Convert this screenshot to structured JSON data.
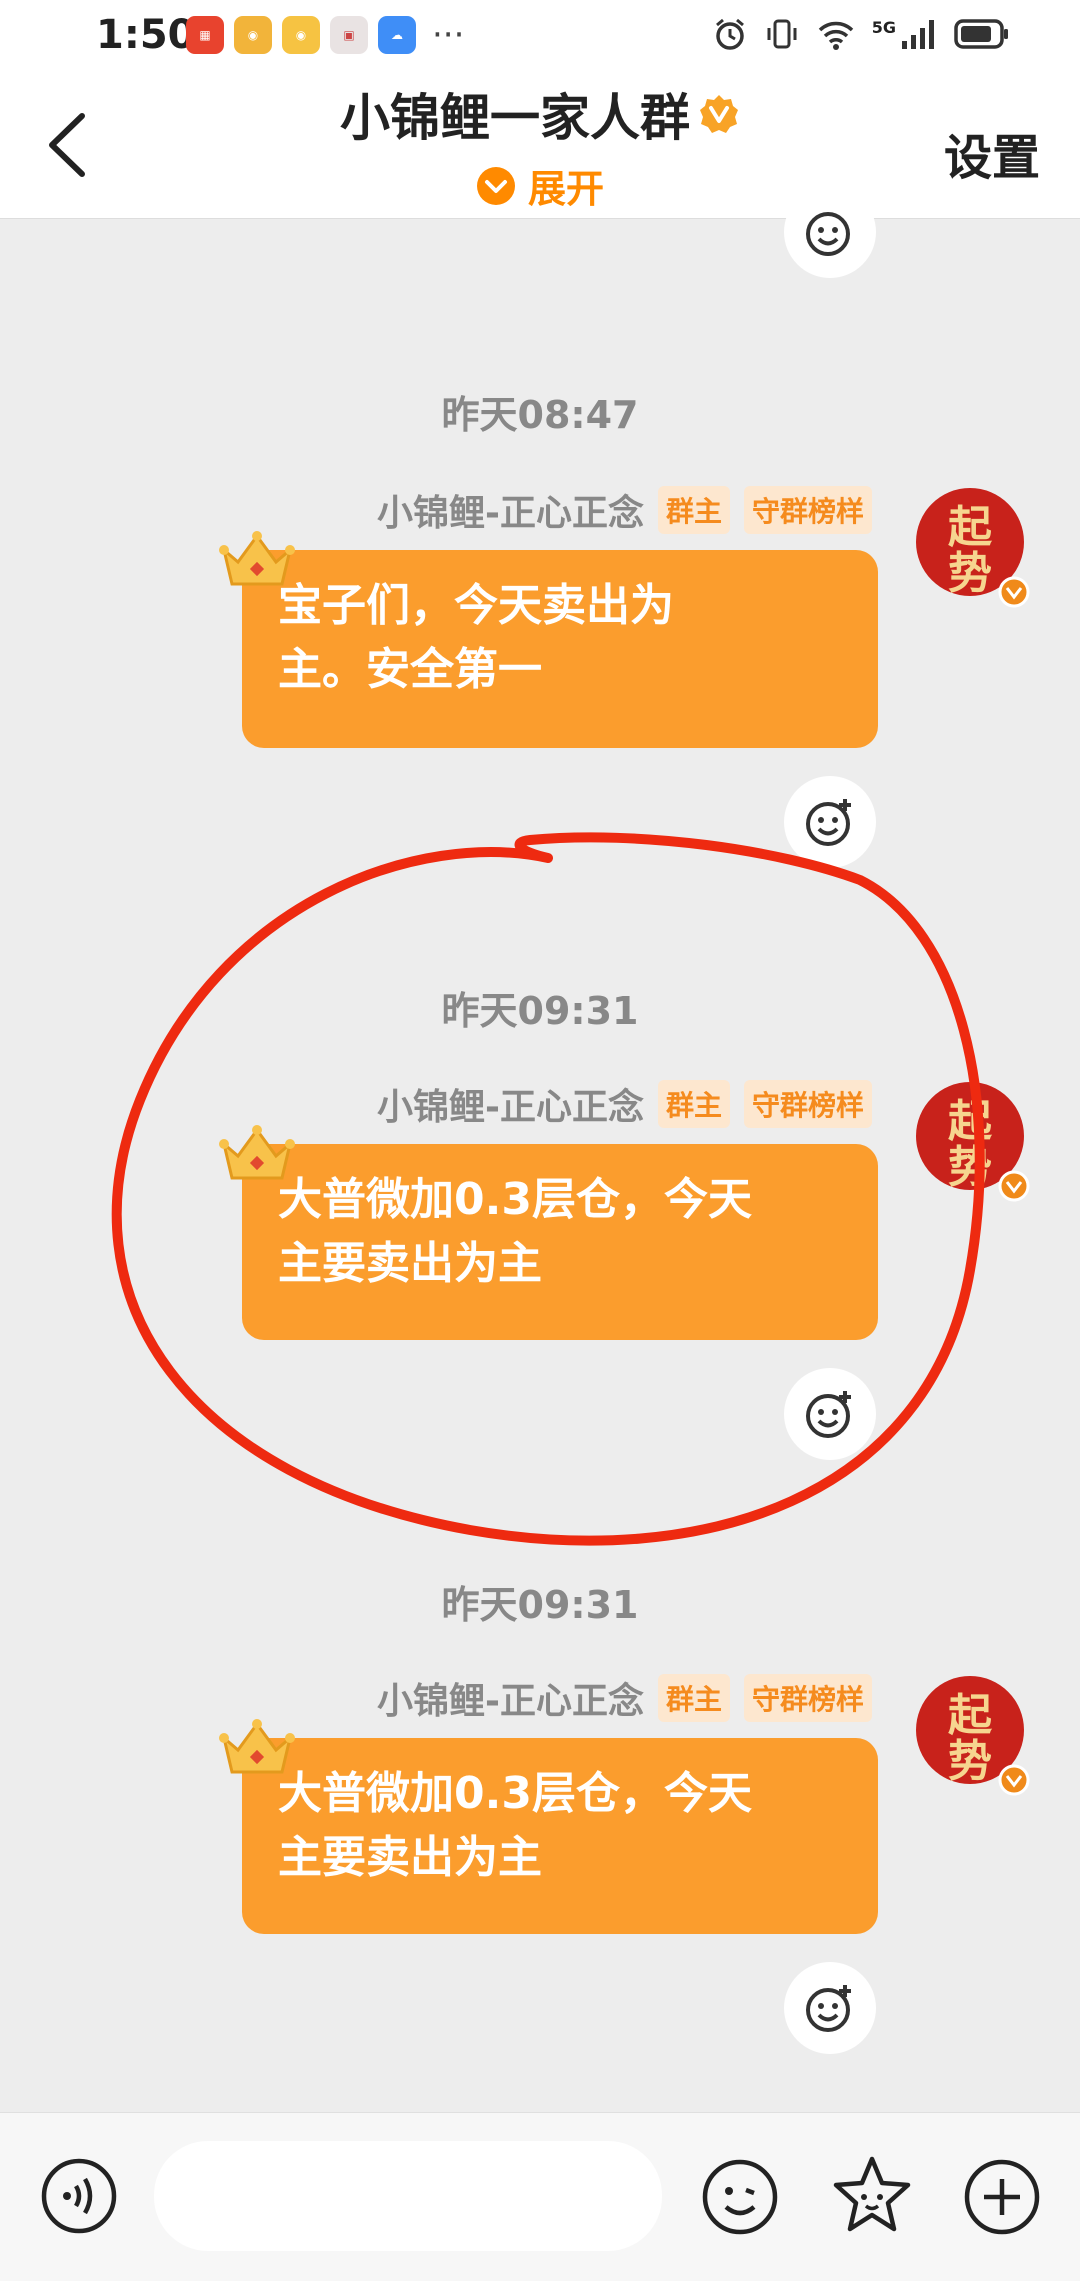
{
  "status_bar": {
    "time": "1:50",
    "app_icons": [
      "huawei-store-icon",
      "weibo-icon",
      "weibo-lite-icon",
      "box-app-icon",
      "cloud-icon"
    ],
    "more": "···",
    "network": "5G"
  },
  "header": {
    "title": "小锦鲤一家人群",
    "expand_label": "展开",
    "settings_label": "设置"
  },
  "messages": [
    {
      "timestamp": "昨天08:47",
      "sender": "小锦鲤-正心正念",
      "tags": [
        "群主",
        "守群榜样"
      ],
      "text_line1": "宝子们，今天卖出为",
      "text_line2": "主。安全第一"
    },
    {
      "timestamp": "昨天09:31",
      "sender": "小锦鲤-正心正念",
      "tags": [
        "群主",
        "守群榜样"
      ],
      "text_line1": "大普微加0.3层仓，今天",
      "text_line2": "主要卖出为主"
    },
    {
      "timestamp": "昨天09:31",
      "sender": "小锦鲤-正心正念",
      "tags": [
        "群主",
        "守群榜样"
      ],
      "text_line1": "大普微加0.3层仓，今天",
      "text_line2": "主要卖出为主"
    }
  ],
  "avatar_text": "起势",
  "colors": {
    "accent": "#ff8a00",
    "bubble": "#fb9d2d",
    "annotation": "#ee2a10"
  }
}
